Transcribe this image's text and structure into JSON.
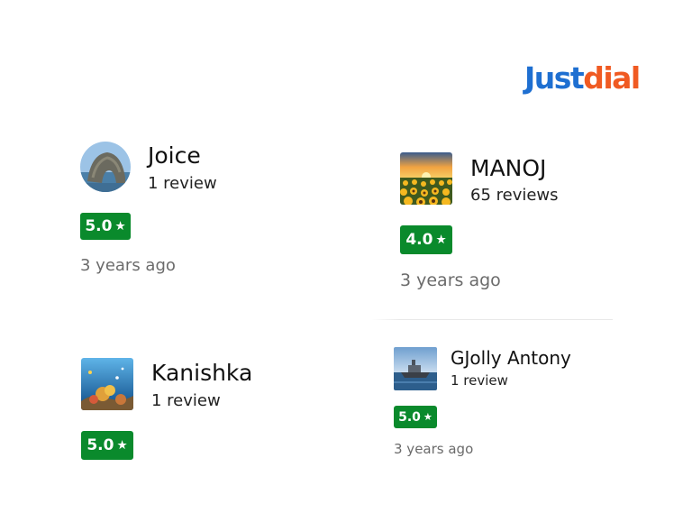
{
  "logo": {
    "part1": "Just",
    "part2": "dial",
    "colors": {
      "just": "#1e6fd1",
      "dial": "#f05a22"
    }
  },
  "badge_color": "#0a8a2c",
  "star_glyph": "★",
  "reviews": [
    {
      "name": "Joice",
      "review_count": "1 review",
      "rating": "5.0",
      "time": "3 years ago",
      "avatar_icon": "rock-arch-landscape"
    },
    {
      "name": "MANOJ",
      "review_count": "65 reviews",
      "rating": "4.0",
      "time": "3 years ago",
      "avatar_icon": "sunflower-field-sunset"
    },
    {
      "name": "Kanishka",
      "review_count": "1 review",
      "rating": "5.0",
      "time": "",
      "avatar_icon": "coral-reef-underwater"
    },
    {
      "name": "GJolly Antony",
      "review_count": "1 review",
      "rating": "5.0",
      "time": "3 years ago",
      "avatar_icon": "ship-at-sea"
    }
  ]
}
